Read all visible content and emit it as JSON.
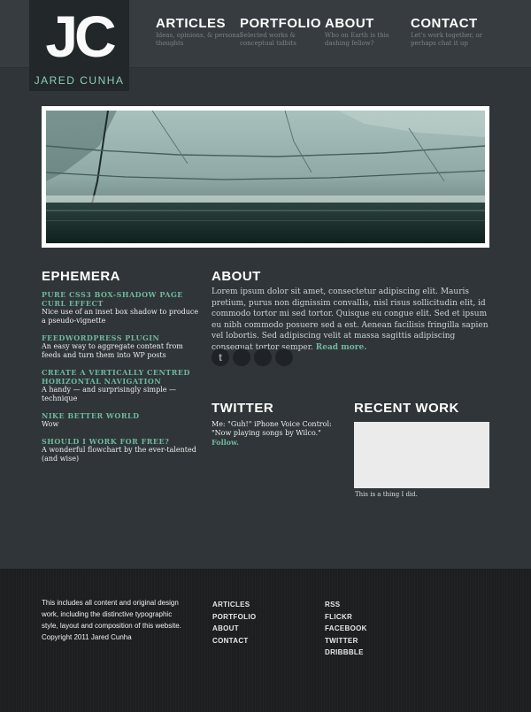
{
  "logo": {
    "mark": "JC",
    "name": "JARED CUNHA"
  },
  "nav": [
    {
      "title": "ARTICLES",
      "sub": "Ideas, opinions, & personal thoughts"
    },
    {
      "title": "PORTFOLIO",
      "sub": "Selected works & conceptual tidbits"
    },
    {
      "title": "ABOUT",
      "sub": "Who on Earth is this dashing fellow?"
    },
    {
      "title": "CONTACT",
      "sub": "Let's work together, or perhaps chat it up"
    }
  ],
  "ephemera": {
    "heading": "EPHEMERA",
    "items": [
      {
        "title": "PURE CSS3 BOX-SHADOW PAGE CURL EFFECT",
        "desc": "Nice use of an inset box shadow to produce a pseudo-vignette"
      },
      {
        "title": "FEEDWORDPRESS PLUGIN",
        "desc": "An easy way to aggregate content from feeds and turn them into WP posts"
      },
      {
        "title": "CREATE A VERTICALLY CENTRED HORIZONTAL NAVIGATION",
        "desc": "A handy — and surprisingly simple — technique"
      },
      {
        "title": "NIKE BETTER WORLD",
        "desc": "Wow"
      },
      {
        "title": "SHOULD I WORK FOR FREE?",
        "desc": "A wonderful flowchart by the ever-talented (and wise)"
      }
    ]
  },
  "about": {
    "heading": "ABOUT",
    "text": "Lorem ipsum dolor sit amet, consectetur adipiscing elit. Mauris pretium, purus non dignissim convallis, nisl risus sollicitudin elit, id commodo tortor mi sed tortor. Quisque eu congue elit. Sed et ipsum eu nibh commodo posuere sed a est. Aenean facilisis fringilla sapien vel lobortis. Sed adipiscing velit at massa sagittis adipiscing consequat tortor semper.",
    "read_more": "Read more."
  },
  "social_icons": [
    "twitter-icon",
    "social-icon",
    "social-icon",
    "social-icon"
  ],
  "twitter": {
    "heading": "TWITTER",
    "tweet": "Me: \"Guh!\" iPhone Voice Control: \"Now playing songs by Wilco.\"",
    "follow": "Follow."
  },
  "recent": {
    "heading": "RECENT WORK",
    "caption": "This is a thing I did."
  },
  "footer": {
    "text": "This includes all content and original design work, including the distinctive typographic style, layout and composition of this website. Copyright 2011 Jared Cunha",
    "nav": [
      "ARTICLES",
      "PORTFOLIO",
      "ABOUT",
      "CONTACT"
    ],
    "social": [
      "RSS",
      "FLICKR",
      "FACEBOOK",
      "TWITTER",
      "DRIBBBLE"
    ]
  },
  "colors": {
    "accent": "#6fb89c",
    "background": "#2f3538",
    "footer": "#1c1e1f"
  }
}
